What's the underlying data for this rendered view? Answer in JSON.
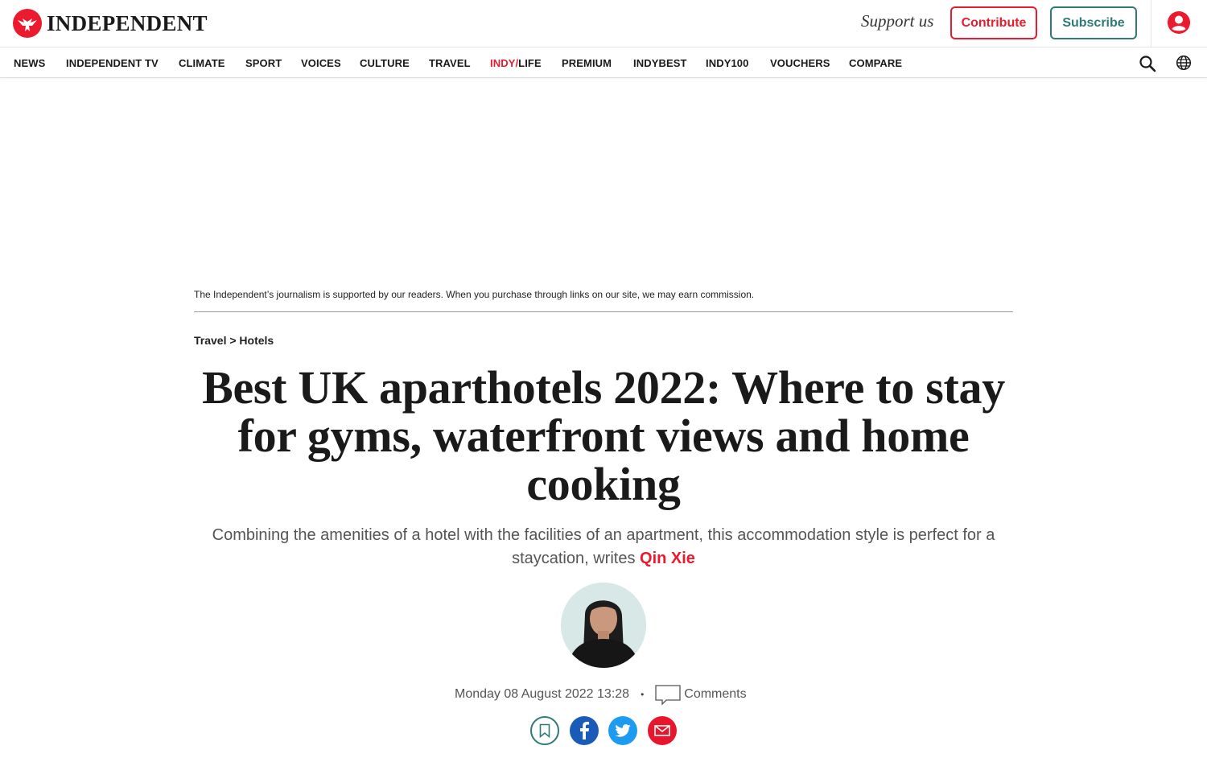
{
  "header": {
    "logo_text": "INDEPENDENT",
    "support_text": "Support us",
    "contribute_label": "Contribute",
    "subscribe_label": "Subscribe"
  },
  "nav": {
    "items": [
      "NEWS",
      "INDEPENDENT TV",
      "CLIMATE",
      "SPORT",
      "VOICES",
      "CULTURE",
      "TRAVEL"
    ],
    "indy_part1": "INDY/",
    "indy_part2": "LIFE",
    "items_after": [
      "PREMIUM",
      "INDYBEST",
      "INDY100",
      "VOUCHERS",
      "COMPARE"
    ]
  },
  "article": {
    "disclaimer": "The Independent’s journalism is supported by our readers. When you purchase through links on our site, we may earn commission.",
    "breadcrumb": "Travel > Hotels",
    "headline": "Best UK aparthotels 2022: Where to stay for gyms, waterfront views and home cooking",
    "standfirst": "Combining the amenities of a hotel with the facilities of an apartment, this accommodation style is perfect for a staycation, writes ",
    "author": "Qin Xie",
    "date": "Monday 08 August 2022 13:28",
    "separator": "•",
    "comments_label": "Comments"
  },
  "colors": {
    "brand_red": "#ec1a2e",
    "brand_teal": "#2f7a76",
    "facebook": "#1b5bb8",
    "twitter": "#1d9bf0",
    "email": "#e8152c"
  },
  "icons": [
    "eagle-logo-icon",
    "account-icon",
    "search-icon",
    "globe-icon",
    "comment-icon",
    "bookmark-icon",
    "facebook-icon",
    "twitter-icon",
    "email-icon"
  ]
}
